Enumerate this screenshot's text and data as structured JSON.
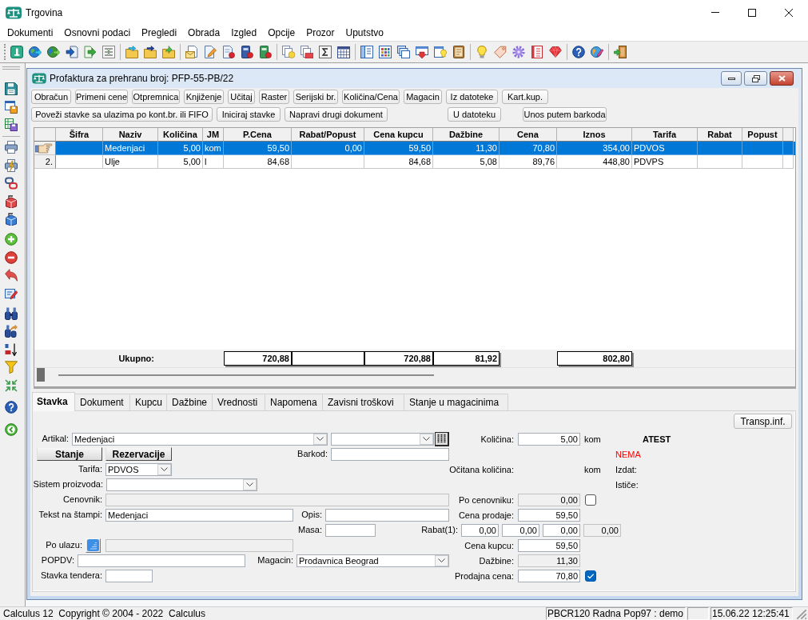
{
  "window": {
    "title": "Trgovina"
  },
  "menu": [
    "Dokumenti",
    "Osnovni podaci",
    "Pregledi",
    "Obrada",
    "Izgled",
    "Opcije",
    "Prozor",
    "Uputstvo"
  ],
  "document_window": {
    "title": "Profaktura za prehranu broj: PFP-55-PB/22",
    "button_rows": [
      [
        "Obračun",
        "Primeni cene",
        "Otpremnica",
        "Knjiženje",
        "Učitaj",
        "Raster",
        "Serijski br.",
        "Količina/Cena",
        "Magacin",
        "Iz datoteke",
        "Kart.kup."
      ],
      [
        "Poveži stavke sa ulazima po kont.br. ili FIFO",
        "Iniciraj stavke",
        "Napravi drugi dokument",
        "U datoteku",
        "Unos putem barkoda"
      ]
    ],
    "table": {
      "columns": [
        "Šifra",
        "Naziv",
        "Količina",
        "JM",
        "P.Cena",
        "Rabat/Popust",
        "Cena kupcu",
        "Dažbine",
        "Cena",
        "Iznos",
        "Tarifa",
        "Rabat",
        "Popust"
      ],
      "rows": [
        {
          "selected": true,
          "naziv": "Medenjaci",
          "kolicina": "5,00",
          "jm": "kom",
          "p_cena": "59,50",
          "rabat_popust": "0,00",
          "cena_kupcu": "59,50",
          "dazbine": "11,30",
          "cena": "70,80",
          "iznos": "354,00",
          "tarifa": "PDVOS"
        },
        {
          "selected": false,
          "number": "2.",
          "naziv": "Ulje",
          "kolicina": "5,00",
          "jm": "l",
          "p_cena": "84,68",
          "cena_kupcu": "84,68",
          "dazbine": "5,08",
          "cena": "89,76",
          "iznos": "448,80",
          "tarifa": "PDVPS"
        }
      ],
      "totals": {
        "label": "Ukupno:",
        "p_cena": "720,88",
        "cena_kupcu": "720,88",
        "dazbine": "81,92",
        "iznos": "802,80"
      }
    },
    "tabs": [
      {
        "label": "Stavka",
        "selected": true
      },
      {
        "label": "Dokument",
        "selected": false
      },
      {
        "label": "Kupcu",
        "selected": false
      },
      {
        "label": "Dažbine",
        "selected": false
      },
      {
        "label": "Vrednosti",
        "selected": false
      },
      {
        "label": "Napomena",
        "selected": false
      },
      {
        "label": "Zavisni troškovi",
        "selected": false
      },
      {
        "label": "Stanje u magacinima",
        "selected": false
      }
    ],
    "transport_button": "Transp.inf.",
    "form": {
      "artikal": {
        "label": "Artikal:",
        "value": "Medenjaci"
      },
      "stock_buttons": [
        "Stanje",
        "Rezervacije"
      ],
      "barkod": {
        "label": "Barkod:",
        "disabled": false
      },
      "tarifa": {
        "label": "Tarifa:",
        "value": "PDVOS"
      },
      "sistem_proizvoda": {
        "label": "Sistem proizvoda:"
      },
      "cenovnik": {
        "label": "Cenovnik:",
        "disabled": true
      },
      "tekst_na_stampi": {
        "label": "Tekst na štampi:",
        "value": "Medenjaci",
        "disabled": false
      },
      "opis": {
        "label": "Opis:",
        "disabled": false
      },
      "masa": {
        "label": "Masa:",
        "disabled": false
      },
      "po_ulazu": {
        "label": "Po ulazu:",
        "disabled": true
      },
      "popdv": {
        "label": "POPDV:",
        "disabled": false
      },
      "magacin": {
        "label": "Magacin:",
        "value": "Prodavnica Beograd"
      },
      "stavka_tendera": {
        "label": "Stavka tendera:",
        "disabled": false
      },
      "kolicina": {
        "label": "Količina:",
        "value": "5,00",
        "unit": "kom",
        "disabled": false
      },
      "ocitana_kolicina": {
        "label": "Očitana količina:",
        "unit": "kom"
      },
      "po_cenovniku": {
        "label": "Po cenovniku:",
        "value": "0,00",
        "disabled": true,
        "checked": false
      },
      "cena_prodaje": {
        "label": "Cena prodaje:",
        "value": "59,50",
        "disabled": false
      },
      "rabat": {
        "label": "Rabat(1):",
        "fields": [
          {
            "value": "0,00",
            "disabled": false
          },
          {
            "value": "0,00",
            "disabled": false
          },
          {
            "value": "0,00",
            "disabled": false
          },
          {
            "value": "0,00",
            "disabled": true
          }
        ]
      },
      "cena_kupcu": {
        "label": "Cena kupcu:",
        "value": "59,50",
        "disabled": false
      },
      "dazbine": {
        "label": "Dažbine:",
        "value": "11,30",
        "disabled": true
      },
      "prodajna_cena": {
        "label": "Prodajna cena:",
        "value": "70,80",
        "disabled": false,
        "checked": true
      },
      "atest": {
        "title": "ATEST",
        "status": "NEMA",
        "issued_label": "Izdat:",
        "expires_label": "Ističe:"
      }
    }
  },
  "status_bar": {
    "copyright": "Calculus 12  Copyright © 2004 - 2022  Calculus",
    "user": "PBCR120 Radna Pop97 : demo",
    "datetime": "15.06.22 12:25:41"
  }
}
